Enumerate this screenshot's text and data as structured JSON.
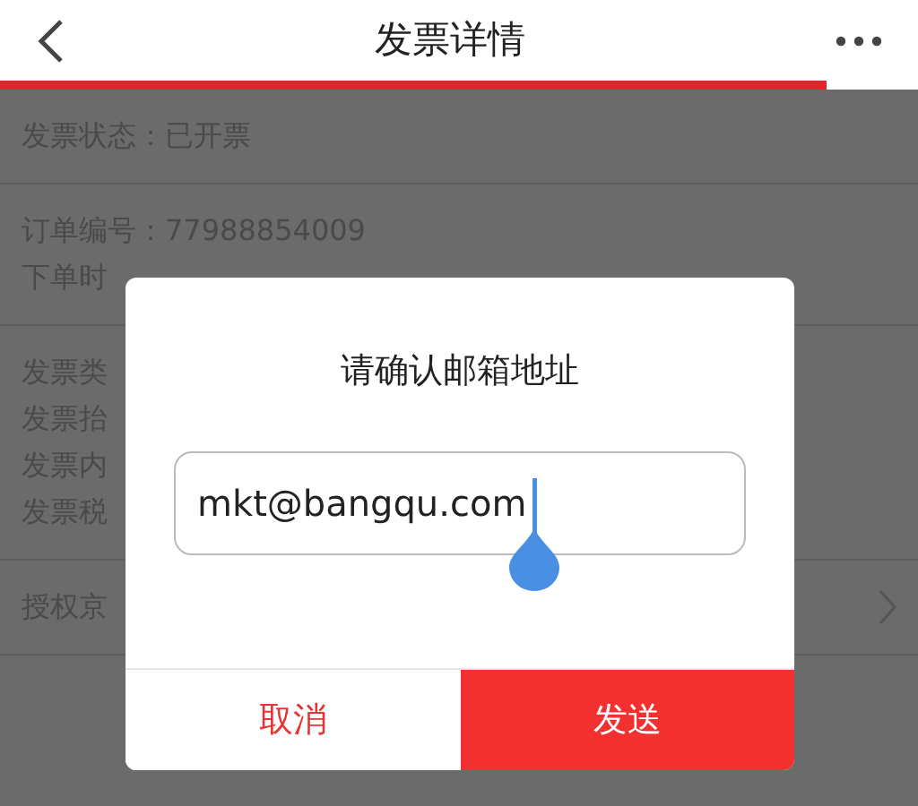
{
  "header": {
    "title": "发票详情"
  },
  "loading_bar": {
    "level": 0.9
  },
  "sections": [
    {
      "lines": [
        "发票状态：已开票"
      ]
    },
    {
      "lines": [
        "订单编号：77988854009",
        "下单时"
      ]
    },
    {
      "lines": [
        "发票类",
        "发票抬",
        "发票内",
        "发票税"
      ]
    },
    {
      "lines": [
        "授权京"
      ],
      "chevron": true
    }
  ],
  "dialog": {
    "title": "请确认邮箱地址",
    "email_field": {
      "value": "mkt@bangqu.com"
    },
    "buttons": [
      {
        "label": "取消",
        "kind": "cancel"
      },
      {
        "label": "发送",
        "kind": "confirm"
      }
    ]
  }
}
